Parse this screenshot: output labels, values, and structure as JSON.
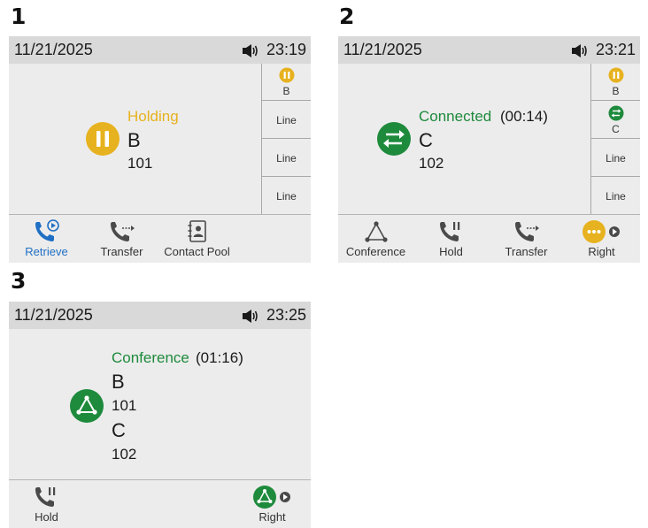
{
  "labels": {
    "one": "1",
    "two": "2",
    "three": "3"
  },
  "screen1": {
    "date": "11/21/2025",
    "time": "23:19",
    "status": "Holding",
    "name": "B",
    "number": "101",
    "line_keys": [
      "B",
      "Line",
      "Line",
      "Line"
    ],
    "softkeys": [
      "Retrieve",
      "Transfer",
      "Contact Pool"
    ]
  },
  "screen2": {
    "date": "11/21/2025",
    "time": "23:21",
    "status": "Connected",
    "duration": "(00:14)",
    "name": "C",
    "number": "102",
    "line_keys": [
      "B",
      "C",
      "Line",
      "Line"
    ],
    "softkeys": [
      "Conference",
      "Hold",
      "Transfer",
      "Right"
    ]
  },
  "screen3": {
    "date": "11/21/2025",
    "time": "23:25",
    "status": "Conference",
    "duration": "(01:16)",
    "party1_name": "B",
    "party1_number": "101",
    "party2_name": "C",
    "party2_number": "102",
    "softkeys": [
      "Hold",
      "Right"
    ]
  },
  "colors": {
    "hold_yellow": "#e7b21f",
    "connected_green": "#1e8a3c",
    "active_blue": "#1f6fc4",
    "status_bar": "#d9d9d9",
    "screen_bg": "#ececec"
  }
}
